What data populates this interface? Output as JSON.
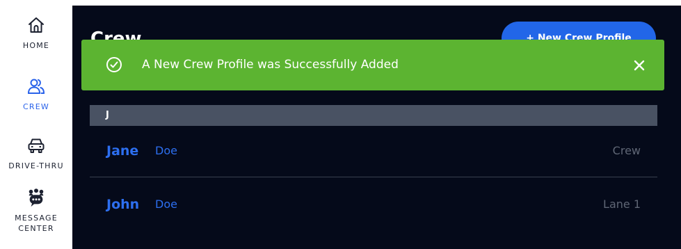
{
  "sidebar": {
    "items": [
      {
        "label": "HOME",
        "icon": "home-icon",
        "active": false
      },
      {
        "label": "CREW",
        "icon": "users-icon",
        "active": true
      },
      {
        "label": "DRIVE-THRU",
        "icon": "car-icon",
        "active": false
      },
      {
        "label": "MESSAGE\nCENTER",
        "icon": "message-center-icon",
        "active": false
      }
    ]
  },
  "header": {
    "title": "Crew",
    "new_button_label": "+ New Crew Profile"
  },
  "toast": {
    "message": "A New Crew Profile was Successfully Added",
    "icon": "check-circle-icon",
    "close_icon": "close-icon"
  },
  "list": {
    "sections": [
      {
        "letter": "J",
        "rows": [
          {
            "first": "Jane",
            "last": "Doe",
            "role": "Crew"
          },
          {
            "first": "John",
            "last": "Doe",
            "role": "Lane 1"
          }
        ]
      }
    ]
  },
  "colors": {
    "accent": "#2962ea",
    "toast_success": "#5cb431",
    "main_background": "#050a1a",
    "section_header": "#495263"
  }
}
